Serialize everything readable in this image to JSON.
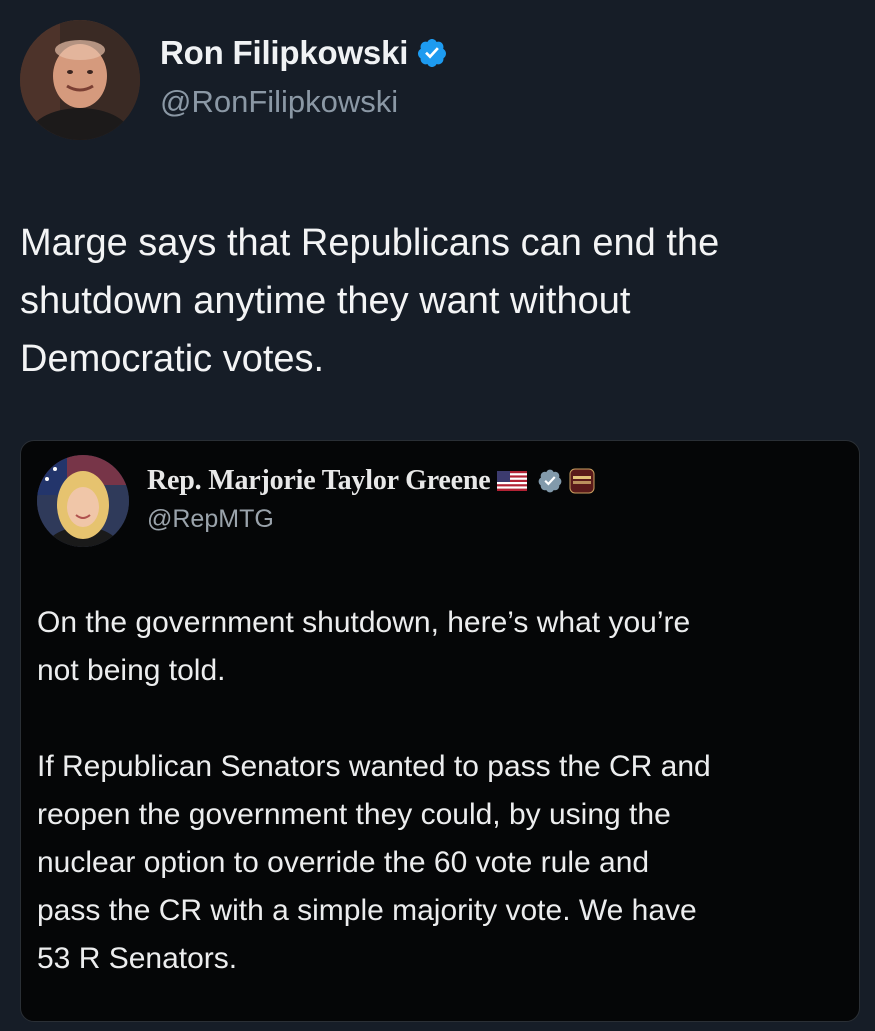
{
  "post": {
    "author": {
      "name": "Ron Filipkowski",
      "handle": "@RonFilipkowski",
      "verified": true,
      "avatar_icon": "person-avatar"
    },
    "text": "Marge says that Republicans can end the\nshutdown anytime they want without\nDemocratic votes."
  },
  "quoted_post": {
    "author": {
      "name": "Rep. Marjorie Taylor Greene",
      "handle": "@RepMTG",
      "badges": [
        "us-flag-icon",
        "gov-verified-icon",
        "org-badge-icon"
      ],
      "avatar_icon": "person-avatar"
    },
    "paragraphs": [
      "On the government shutdown, here’s what you’re\nnot being told.",
      "If Republican Senators wanted to pass the CR and\nreopen the government they could, by using the\nnuclear option to override the 60 vote rule and\npass the CR with a simple majority vote. We have\n53 R Senators."
    ]
  },
  "colors": {
    "background": "#161d27",
    "quote_background": "#050607",
    "verified_blue": "#1d9bf0",
    "text_primary": "#f3f4f5",
    "text_secondary": "#8b98a5"
  }
}
